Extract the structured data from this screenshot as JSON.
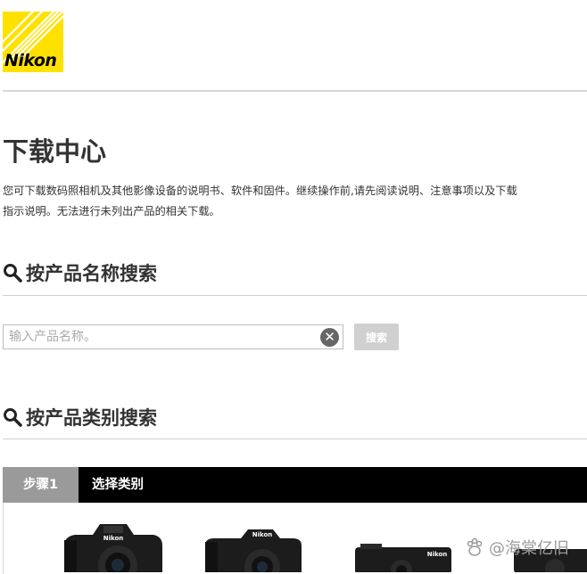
{
  "brand": {
    "logo_text": "Nikon",
    "accent": "#ffe100"
  },
  "page": {
    "title": "下载中心",
    "intro_line1": "您可下载数码照相机及其他影像设备的说明书、软件和固件。继续操作前,请先阅读说明、注意事项以及下载",
    "intro_line2": "指示说明。无法进行未列出产品的相关下载。"
  },
  "search_by_name": {
    "heading": "按产品名称搜索",
    "placeholder": "输入产品名称。",
    "value": "",
    "button_label": "搜索"
  },
  "search_by_category": {
    "heading": "按产品类别搜索",
    "step_tag": "步骤1",
    "step_label": "选择类别"
  },
  "products": [
    {
      "icon": "dslr-camera-icon",
      "brand_text": "Nikon"
    },
    {
      "icon": "mirrorless-camera-icon",
      "brand_text": "Nikon"
    },
    {
      "icon": "compact-camera-icon",
      "brand_text": "Nikon"
    },
    {
      "icon": "compact-camera-icon"
    }
  ],
  "watermark": {
    "text": "@海棠亿旧"
  },
  "colors": {
    "step_tag_bg": "#9a9a9a",
    "step_bar_bg": "#000000",
    "search_button_bg": "#d0d0d0"
  }
}
